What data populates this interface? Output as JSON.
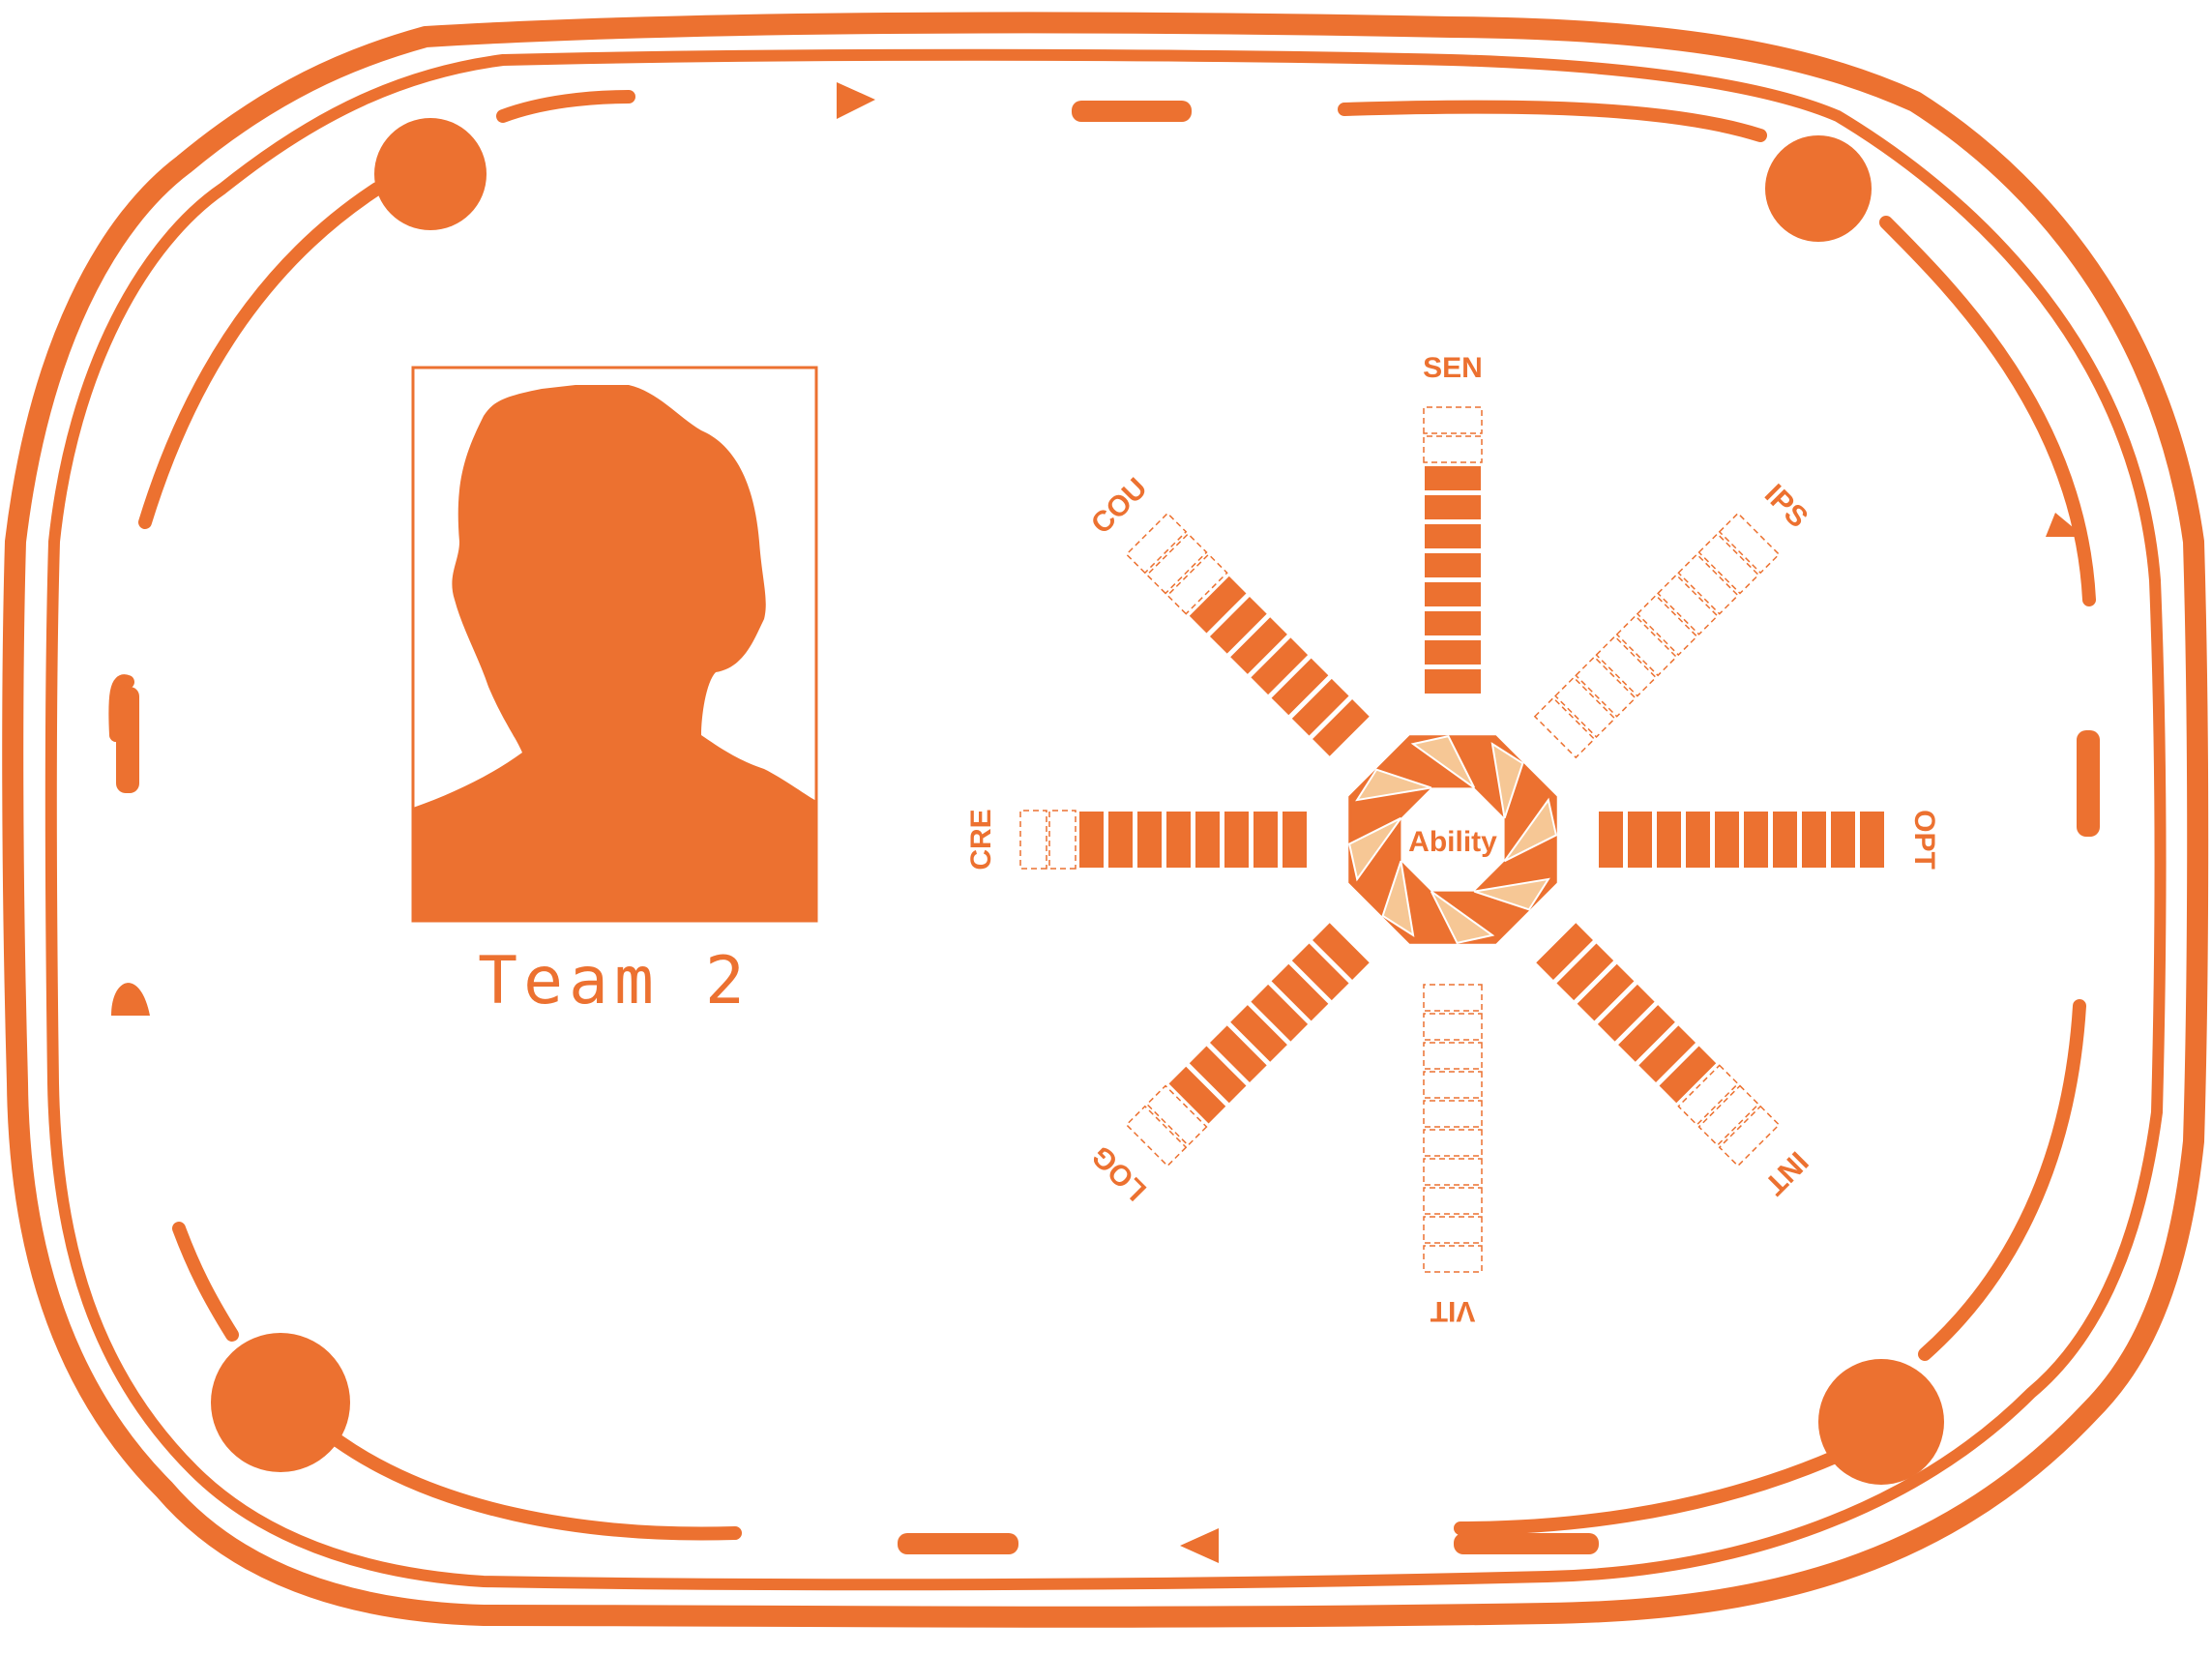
{
  "colors": {
    "accent": "#EC7130",
    "accent_light": "#F6C795",
    "background": "#FFFFFF"
  },
  "card": {
    "frame_icon": "ornate-frame",
    "avatar_icon": "person-silhouette-icon",
    "team_name": "Team 2"
  },
  "ability": {
    "center_label": "Ability",
    "max_level": 10,
    "stats": [
      {
        "abbr": "SEN",
        "level": 8
      },
      {
        "abbr": "IPS",
        "level": 0
      },
      {
        "abbr": "OPT",
        "level": 10
      },
      {
        "abbr": "INT",
        "level": 7
      },
      {
        "abbr": "VIT",
        "level": 0
      },
      {
        "abbr": "LOG",
        "level": 8
      },
      {
        "abbr": "CRE",
        "level": 8
      },
      {
        "abbr": "COU",
        "level": 7
      }
    ]
  }
}
